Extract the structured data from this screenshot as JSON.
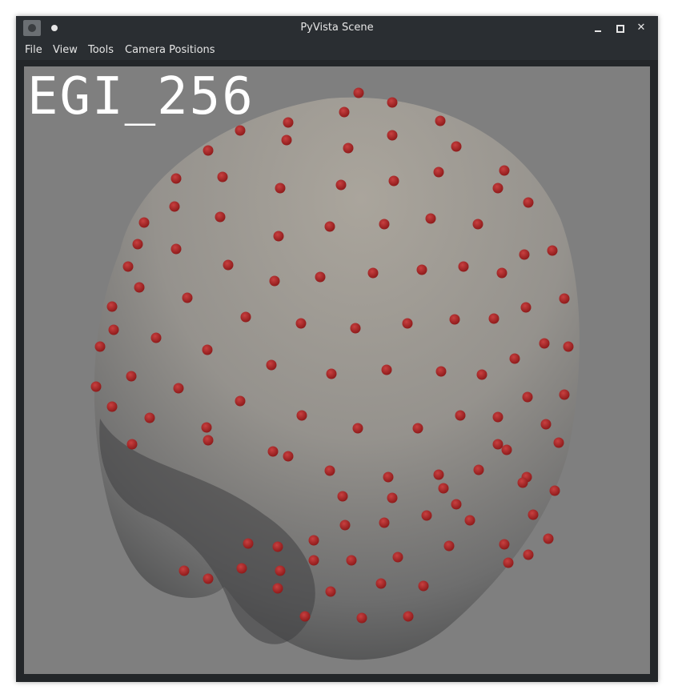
{
  "window": {
    "title": "PyVista Scene",
    "app_icon": "pyvista-icon",
    "controls": [
      "minimize-icon",
      "maximize-icon",
      "close-icon"
    ]
  },
  "menu": {
    "items": [
      "File",
      "View",
      "Tools",
      "Camera Positions"
    ]
  },
  "viewport": {
    "overlay_text": "EGI_256",
    "background": "#7f7f7f",
    "head_color": "#a8a39c",
    "sensor_color": "#b52a2a"
  },
  "colors": {
    "titlebar": "#2a2e32",
    "frame": "#232629",
    "text": "#e6e6e6"
  }
}
